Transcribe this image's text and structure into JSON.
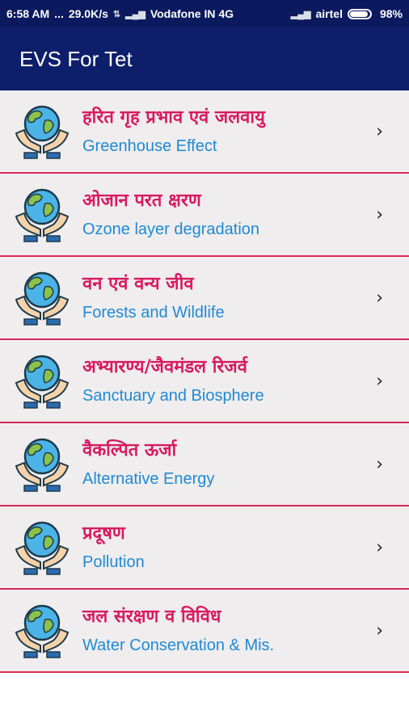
{
  "status_bar": {
    "time": "6:58 AM",
    "dots": "...",
    "speed": "29.0K/s",
    "carrier1": "Vodafone IN 4G",
    "carrier2": "airtel",
    "battery": "98%"
  },
  "app_bar": {
    "title": "EVS For Tet"
  },
  "colors": {
    "primary_dark": "#0b1a5e",
    "primary": "#0d1f6b",
    "hindi": "#d81b60",
    "english": "#1f8ad3",
    "divider": "#d6285a"
  },
  "items": [
    {
      "hindi": "हरित गृह प्रभाव एवं जलवायु",
      "english": "Greenhouse Effect",
      "icon": "globe-hands-icon"
    },
    {
      "hindi": "ओजान परत क्षरण",
      "english": "Ozone layer degradation",
      "icon": "globe-hands-icon"
    },
    {
      "hindi": "वन एवं वन्य जीव",
      "english": "Forests and Wildlife",
      "icon": "globe-hands-icon"
    },
    {
      "hindi": "अभ्यारण्य/जैवमंडल रिजर्व",
      "english": "Sanctuary and Biosphere",
      "icon": "globe-hands-icon"
    },
    {
      "hindi": "वैकल्पित ऊर्जा",
      "english": "Alternative Energy",
      "icon": "globe-hands-icon"
    },
    {
      "hindi": "प्रदूषण",
      "english": "Pollution",
      "icon": "globe-hands-icon"
    },
    {
      "hindi": "जल संरक्षण व विविध",
      "english": "Water Conservation & Mis.",
      "icon": "globe-hands-icon"
    }
  ]
}
